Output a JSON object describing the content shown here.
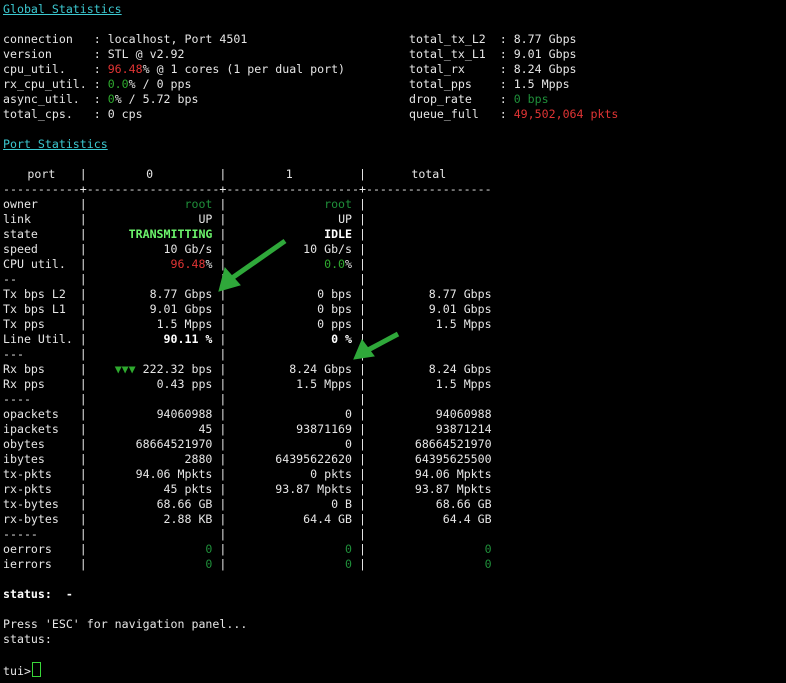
{
  "global": {
    "title": "Global Statistics",
    "left": [
      {
        "label": "connection   : ",
        "parts": [
          {
            "t": "localhost, Port 4501"
          }
        ]
      },
      {
        "label": "version      : ",
        "parts": [
          {
            "t": "STL @ v2.92"
          }
        ]
      },
      {
        "label": "cpu_util.    : ",
        "parts": [
          {
            "t": "96.48",
            "c": "red"
          },
          {
            "t": "% @ 1 cores (1 per dual port)"
          }
        ]
      },
      {
        "label": "rx_cpu_util. : ",
        "parts": [
          {
            "t": "0.0",
            "c": "grn"
          },
          {
            "t": "% / 0 pps"
          }
        ]
      },
      {
        "label": "async_util.  : ",
        "parts": [
          {
            "t": "0",
            "c": "grn"
          },
          {
            "t": "% / 5.72 bps"
          }
        ]
      },
      {
        "label": "total_cps.   : ",
        "parts": [
          {
            "t": "0 cps"
          }
        ]
      }
    ],
    "right": [
      {
        "label": "total_tx_L2  : ",
        "parts": [
          {
            "t": "8.77 Gbps"
          }
        ]
      },
      {
        "label": "total_tx_L1  : ",
        "parts": [
          {
            "t": "9.01 Gbps"
          }
        ]
      },
      {
        "label": "total_rx     : ",
        "parts": [
          {
            "t": "8.24 Gbps"
          }
        ]
      },
      {
        "label": "total_pps    : ",
        "parts": [
          {
            "t": "1.5 Mpps"
          }
        ]
      },
      {
        "label": "drop_rate    : ",
        "parts": [
          {
            "t": "0 bps",
            "c": "dgrn"
          }
        ]
      },
      {
        "label": "queue_full   : ",
        "parts": [
          {
            "t": "49,502,064 pkts",
            "c": "red"
          }
        ]
      }
    ]
  },
  "port": {
    "title": "Port Statistics",
    "headers": [
      "port",
      "0",
      "1",
      "total"
    ],
    "separator": "-----------+-------------------+-------------------+------------------",
    "rows": [
      {
        "label": "owner",
        "c0": "root",
        "c0c": "dgrn",
        "c1": "root",
        "c1c": "dgrn",
        "tot": ""
      },
      {
        "label": "link",
        "c0": "UP",
        "c1": "UP",
        "tot": ""
      },
      {
        "label": "state",
        "c0": "TRANSMITTING",
        "c0c": "bgrn",
        "c1": "IDLE",
        "c1c": "wb",
        "tot": ""
      },
      {
        "label": "speed",
        "c0": "10 Gb/s",
        "c1": "10 Gb/s",
        "tot": ""
      },
      {
        "label": "CPU util.",
        "c0": "96.48",
        "c0c": "red",
        "c0s": "%",
        "c1": "0.0",
        "c1c": "grn",
        "c1s": "%",
        "tot": ""
      },
      {
        "label": "--",
        "c0": "",
        "c1": "",
        "tot": ""
      },
      {
        "label": "Tx bps L2",
        "c0": "8.77 Gbps",
        "c1": "0 bps",
        "tot": "8.77 Gbps"
      },
      {
        "label": "Tx bps L1",
        "c0": "9.01 Gbps",
        "c1": "0 bps",
        "tot": "9.01 Gbps"
      },
      {
        "label": "Tx pps",
        "c0": "1.5 Mpps",
        "c1": "0 pps",
        "tot": "1.5 Mpps"
      },
      {
        "label": "Line Util.",
        "c0": "90.11 %",
        "c0c": "wb",
        "c1": "0 %",
        "c1c": "wb",
        "tot": ""
      },
      {
        "label": "---",
        "c0": "",
        "c1": "",
        "tot": ""
      },
      {
        "label": "Rx bps",
        "c0p": "▼▼▼",
        "c0": "222.32 bps",
        "c1": "8.24 Gbps",
        "tot": "8.24 Gbps"
      },
      {
        "label": "Rx pps",
        "c0": "0.43 pps",
        "c1": "1.5 Mpps",
        "tot": "1.5 Mpps"
      },
      {
        "label": "----",
        "c0": "",
        "c1": "",
        "tot": ""
      },
      {
        "label": "opackets",
        "c0": "94060988",
        "c1": "0",
        "tot": "94060988"
      },
      {
        "label": "ipackets",
        "c0": "45",
        "c1": "93871169",
        "tot": "93871214"
      },
      {
        "label": "obytes",
        "c0": "68664521970",
        "c1": "0",
        "tot": "68664521970"
      },
      {
        "label": "ibytes",
        "c0": "2880",
        "c1": "64395622620",
        "tot": "64395625500"
      },
      {
        "label": "tx-pkts",
        "c0": "94.06 Mpkts",
        "c1": "0 pkts",
        "tot": "94.06 Mpkts"
      },
      {
        "label": "rx-pkts",
        "c0": "45 pkts",
        "c1": "93.87 Mpkts",
        "tot": "93.87 Mpkts"
      },
      {
        "label": "tx-bytes",
        "c0": "68.66 GB",
        "c1": "0 B",
        "tot": "68.66 GB"
      },
      {
        "label": "rx-bytes",
        "c0": "2.88 KB",
        "c1": "64.4 GB",
        "tot": "64.4 GB"
      },
      {
        "label": "-----",
        "c0": "",
        "c1": "",
        "tot": ""
      },
      {
        "label": "oerrors",
        "c0": "0",
        "c0c": "dgrn",
        "c1": "0",
        "c1c": "dgrn",
        "tot": "0",
        "totc": "dgrn"
      },
      {
        "label": "ierrors",
        "c0": "0",
        "c0c": "dgrn",
        "c1": "0",
        "c1c": "dgrn",
        "tot": "0",
        "totc": "dgrn"
      }
    ]
  },
  "status_line": {
    "label": "status:",
    "value": "-"
  },
  "help": "Press 'ESC' for navigation panel...",
  "status_plain": "status:",
  "prompt": "tui>",
  "colors": {
    "background": "#000000",
    "text": "#e6e6e6",
    "title": "#3cc8d0",
    "red": "#e03434",
    "green": "#2eaa2e",
    "arrow": "#2fa83a"
  }
}
